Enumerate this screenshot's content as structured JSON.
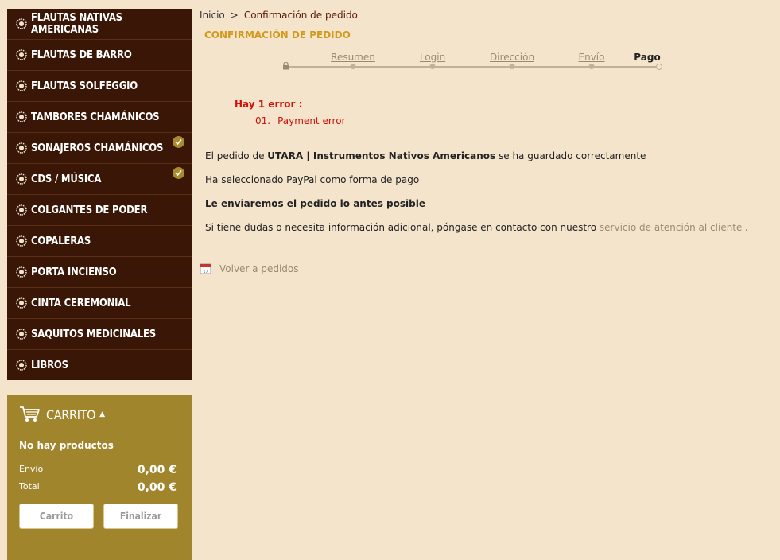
{
  "menu": [
    {
      "label": "FLAUTAS NATIVAS AMERICANAS",
      "expandable": false
    },
    {
      "label": "FLAUTAS DE BARRO",
      "expandable": false
    },
    {
      "label": "FLAUTAS SOLFEGGIO",
      "expandable": false
    },
    {
      "label": "TAMBORES CHAMÁNICOS",
      "expandable": false
    },
    {
      "label": "SONAJEROS CHAMÁNICOS",
      "expandable": true
    },
    {
      "label": "CDS / MÚSICA",
      "expandable": true
    },
    {
      "label": "COLGANTES DE PODER",
      "expandable": false
    },
    {
      "label": "COPALERAS",
      "expandable": false
    },
    {
      "label": "PORTA INCIENSO",
      "expandable": false
    },
    {
      "label": "CINTA CEREMONIAL",
      "expandable": false
    },
    {
      "label": "SAQUITOS MEDICINALES",
      "expandable": false
    },
    {
      "label": "LIBROS",
      "expandable": false
    }
  ],
  "cart": {
    "title": "CARRITO",
    "empty_text": "No hay productos",
    "shipping_label": "Envío",
    "shipping_value": "0,00 €",
    "total_label": "Total",
    "total_value": "0,00 €",
    "cart_button": "Carrito",
    "checkout_button": "Finalizar"
  },
  "breadcrumb": {
    "home": "Inicio",
    "separator": ">",
    "current": "Confirmación de pedido"
  },
  "page_title": "CONFIRMACIÓN DE PEDIDO",
  "steps": [
    {
      "label": "Resumen",
      "active": false
    },
    {
      "label": "Login",
      "active": false
    },
    {
      "label": "Dirección",
      "active": false
    },
    {
      "label": "Envío",
      "active": false
    },
    {
      "label": "Pago",
      "active": true
    }
  ],
  "error": {
    "title": "Hay 1 error :",
    "items": [
      {
        "num": "01.",
        "text": "Payment error"
      }
    ]
  },
  "messages": {
    "saved_prefix": "El pedido de",
    "shop_name": "UTARA | Instrumentos Nativos Americanos",
    "saved_suffix": "se ha guardado correctamente",
    "payment": "Ha seleccionado PayPal como forma de pago",
    "sending": "Le enviaremos el pedido lo antes posible",
    "contact_prefix": "Si tiene dudas o necesita información adicional, póngase en contacto con nuestro",
    "contact_link": "servicio de atención al cliente",
    "contact_suffix": "."
  },
  "back_link": "Volver a pedidos",
  "colors": {
    "background": "#f5e4cc",
    "sidebar": "#3a1606",
    "cart": "#a0852c",
    "accent": "#d29a1d",
    "error": "#d0110a"
  }
}
